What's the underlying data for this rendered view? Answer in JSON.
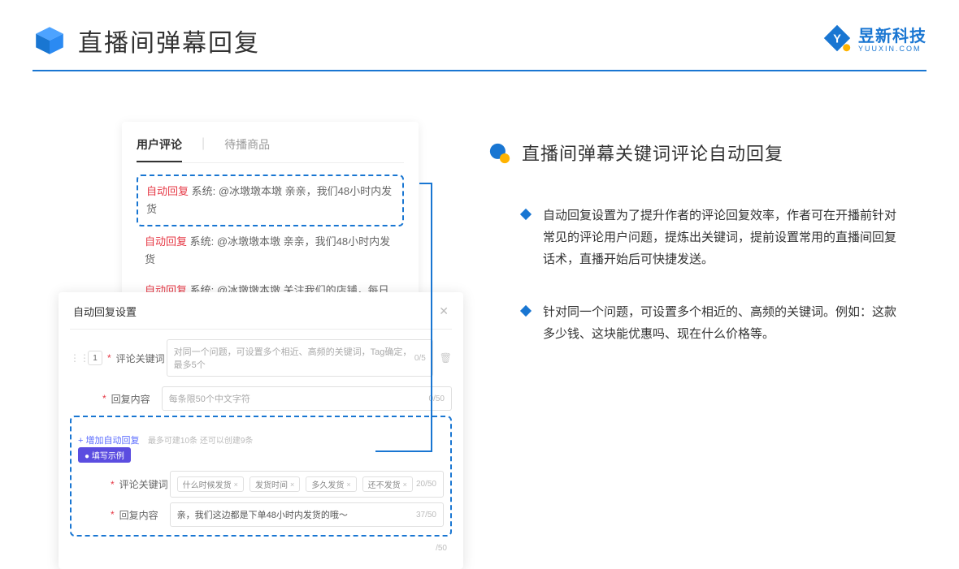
{
  "header": {
    "title": "直播间弹幕回复"
  },
  "brand": {
    "name": "昱新科技",
    "sub": "YUUXIN.COM"
  },
  "comments_card": {
    "tabs": {
      "active": "用户评论",
      "inactive": "待播商品"
    },
    "items": [
      {
        "badge": "自动回复",
        "text": "系统: @冰墩墩本墩 亲亲，我们48小时内发货"
      },
      {
        "badge": "自动回复",
        "text": "系统: @冰墩墩本墩 亲亲，我们48小时内发货"
      },
      {
        "badge": "自动回复",
        "text": "系统: @冰墩墩本墩 关注我们的店铺，每日都有热门推荐呦～"
      }
    ]
  },
  "settings_card": {
    "title": "自动回复设置",
    "row_number": "1",
    "fields": {
      "keyword_label": "评论关键词",
      "keyword_placeholder": "对同一个问题，可设置多个相近、高频的关键词，Tag确定，最多5个",
      "keyword_counter": "0/5",
      "content_label": "回复内容",
      "content_placeholder": "每条限50个中文字符",
      "content_counter": "0/50"
    },
    "add_link": "+ 增加自动回复",
    "add_hint": "最多可建10条 还可以创建9条",
    "example": {
      "badge": "● 填写示例",
      "keyword_label": "评论关键词",
      "tags": [
        "什么时候发货",
        "发货时间",
        "多久发货",
        "还不发货"
      ],
      "keyword_counter": "20/50",
      "content_label": "回复内容",
      "content_text": "亲，我们这边都是下单48小时内发货的哦～",
      "content_counter": "37/50"
    },
    "outer_counter": "/50"
  },
  "right": {
    "title": "直播间弹幕关键词评论自动回复",
    "bullets": [
      "自动回复设置为了提升作者的评论回复效率，作者可在开播前针对常见的评论用户问题，提炼出关键词，提前设置常用的直播间回复话术，直播开始后可快捷发送。",
      "针对同一个问题，可设置多个相近的、高频的关键词。例如：这款多少钱、这块能优惠吗、现在什么价格等。"
    ]
  }
}
